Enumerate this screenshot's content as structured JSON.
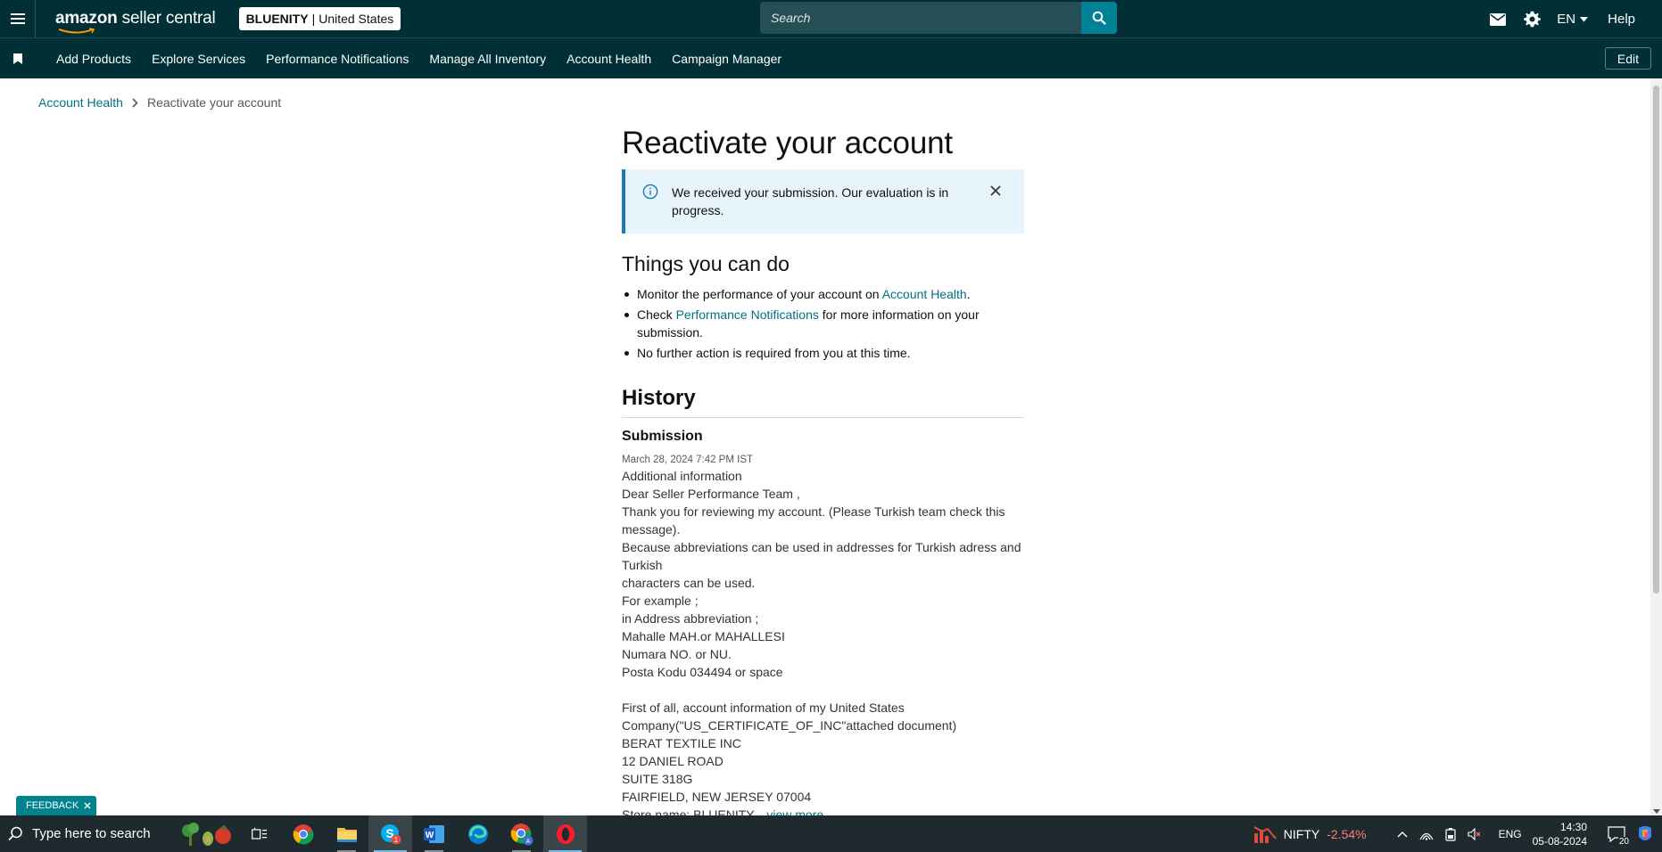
{
  "topbar": {
    "logo_main": "amazon",
    "logo_sub": "seller central",
    "store_name": "BLUENITY",
    "separator": "|",
    "marketplace": "United States",
    "search_placeholder": "Search",
    "language": "EN",
    "help_label": "Help"
  },
  "subnav": {
    "items": [
      "Add Products",
      "Explore Services",
      "Performance Notifications",
      "Manage All Inventory",
      "Account Health",
      "Campaign Manager"
    ],
    "edit_label": "Edit"
  },
  "breadcrumb": {
    "parent": "Account Health",
    "current": "Reactivate your account"
  },
  "main": {
    "title": "Reactivate your account",
    "alert_text": "We received your submission. Our evaluation is in progress.",
    "things_title": "Things you can do",
    "todo": [
      {
        "before": "Monitor the performance of your account on ",
        "link": "Account Health",
        "after": "."
      },
      {
        "before": "Check ",
        "link": "Performance Notifications",
        "after": " for more information on your submission."
      },
      {
        "before": "No further action is required from you at this time.",
        "link": "",
        "after": ""
      }
    ],
    "history_title": "History",
    "submission_title": "Submission",
    "submission_date": "March 28, 2024 7:42 PM IST",
    "submission_lines": [
      "Additional information",
      "Dear Seller Performance Team ,",
      "Thank you for reviewing my account. (Please Turkish team check this message).",
      "Because abbreviations can be used in addresses for Turkish adress and Turkish",
      "characters can be used.",
      "For example ;",
      "in Address abbreviation ;",
      "Mahalle MAH.or MAHALLESI",
      "Numara NO. or NU.",
      "Posta Kodu 034494 or space",
      "",
      "First of all, account information of my United States",
      "Company(\"US_CERTIFICATE_OF_INC\"attached document)",
      "BERAT TEXTILE INC",
      "12 DANIEL ROAD",
      "SUITE 318G",
      "FAIRFIELD, NEW JERSEY 07004"
    ],
    "store_line": "Store name: BLUENITY...",
    "view_more": "view more"
  },
  "feedback_label": "FEEDBACK",
  "taskbar": {
    "search_placeholder": "Type here to search",
    "nifty_name": "NIFTY",
    "nifty_change": "-2.54%",
    "lang": "ENG",
    "time": "14:30",
    "date": "05-08-2024",
    "notif_count": "20",
    "skype_badge": "1"
  },
  "colors": {
    "nav_bg": "#002f36",
    "link": "#007185",
    "alert_bg": "#e8f4fb",
    "alert_border": "#1a79b6",
    "feedback_bg": "#00838f"
  }
}
